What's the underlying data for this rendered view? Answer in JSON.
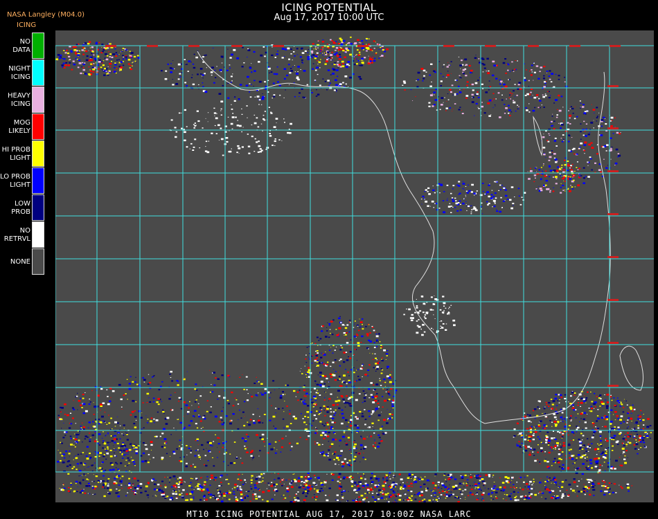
{
  "header": {
    "title": "ICING POTENTIAL",
    "subtitle": "Aug 17, 2017 10:00 UTC",
    "source": "NASA Langley (M04.0)",
    "legend_title": "ICING"
  },
  "legend": [
    {
      "label": "NO DATA",
      "color": "#00b000"
    },
    {
      "label": "NIGHT\nICING",
      "color": "#00ffff"
    },
    {
      "label": "HEAVY\nICING",
      "color": "#e8b0e0"
    },
    {
      "label": "MOG\nLIKELY",
      "color": "#ff0000"
    },
    {
      "label": "HI PROB\nLIGHT",
      "color": "#ffff00"
    },
    {
      "label": "LO PROB\nLIGHT",
      "color": "#0000ff"
    },
    {
      "label": "LOW\nPROB",
      "color": "#000080"
    },
    {
      "label": "NO\nRETRVL",
      "color": "#ffffff"
    },
    {
      "label": "NONE",
      "color": "#4a4a4a"
    }
  ],
  "map": {
    "background": "#4a4a4a",
    "grid_color": "#40e0e0",
    "coast_color": "#e0e0e0",
    "label_color": "#cc2020"
  },
  "footer": {
    "text": "MT10  ICING POTENTIAL   AUG 17, 2017 10:00Z   NASA LARC"
  }
}
